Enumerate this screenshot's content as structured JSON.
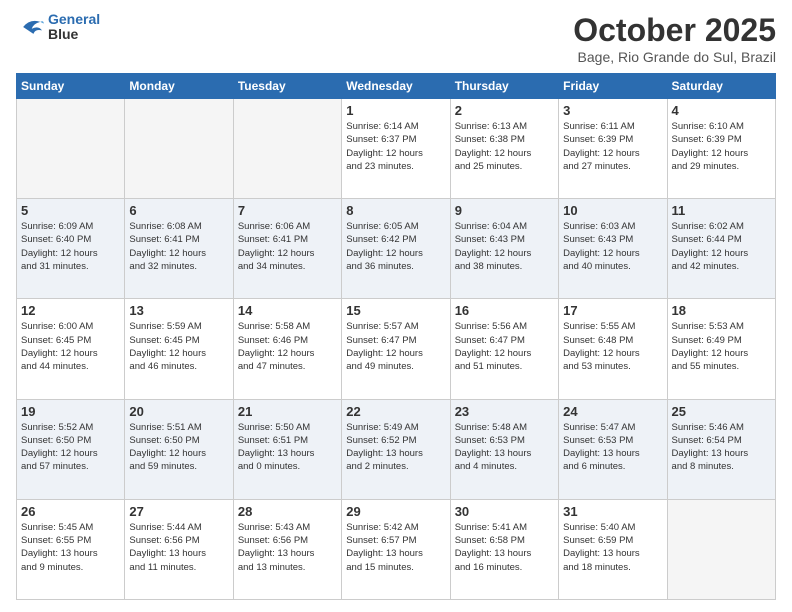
{
  "logo": {
    "line1": "General",
    "line2": "Blue"
  },
  "header": {
    "month": "October 2025",
    "location": "Bage, Rio Grande do Sul, Brazil"
  },
  "days_of_week": [
    "Sunday",
    "Monday",
    "Tuesday",
    "Wednesday",
    "Thursday",
    "Friday",
    "Saturday"
  ],
  "weeks": [
    {
      "alt": false,
      "days": [
        {
          "num": "",
          "info": ""
        },
        {
          "num": "",
          "info": ""
        },
        {
          "num": "",
          "info": ""
        },
        {
          "num": "1",
          "info": "Sunrise: 6:14 AM\nSunset: 6:37 PM\nDaylight: 12 hours\nand 23 minutes."
        },
        {
          "num": "2",
          "info": "Sunrise: 6:13 AM\nSunset: 6:38 PM\nDaylight: 12 hours\nand 25 minutes."
        },
        {
          "num": "3",
          "info": "Sunrise: 6:11 AM\nSunset: 6:39 PM\nDaylight: 12 hours\nand 27 minutes."
        },
        {
          "num": "4",
          "info": "Sunrise: 6:10 AM\nSunset: 6:39 PM\nDaylight: 12 hours\nand 29 minutes."
        }
      ]
    },
    {
      "alt": true,
      "days": [
        {
          "num": "5",
          "info": "Sunrise: 6:09 AM\nSunset: 6:40 PM\nDaylight: 12 hours\nand 31 minutes."
        },
        {
          "num": "6",
          "info": "Sunrise: 6:08 AM\nSunset: 6:41 PM\nDaylight: 12 hours\nand 32 minutes."
        },
        {
          "num": "7",
          "info": "Sunrise: 6:06 AM\nSunset: 6:41 PM\nDaylight: 12 hours\nand 34 minutes."
        },
        {
          "num": "8",
          "info": "Sunrise: 6:05 AM\nSunset: 6:42 PM\nDaylight: 12 hours\nand 36 minutes."
        },
        {
          "num": "9",
          "info": "Sunrise: 6:04 AM\nSunset: 6:43 PM\nDaylight: 12 hours\nand 38 minutes."
        },
        {
          "num": "10",
          "info": "Sunrise: 6:03 AM\nSunset: 6:43 PM\nDaylight: 12 hours\nand 40 minutes."
        },
        {
          "num": "11",
          "info": "Sunrise: 6:02 AM\nSunset: 6:44 PM\nDaylight: 12 hours\nand 42 minutes."
        }
      ]
    },
    {
      "alt": false,
      "days": [
        {
          "num": "12",
          "info": "Sunrise: 6:00 AM\nSunset: 6:45 PM\nDaylight: 12 hours\nand 44 minutes."
        },
        {
          "num": "13",
          "info": "Sunrise: 5:59 AM\nSunset: 6:45 PM\nDaylight: 12 hours\nand 46 minutes."
        },
        {
          "num": "14",
          "info": "Sunrise: 5:58 AM\nSunset: 6:46 PM\nDaylight: 12 hours\nand 47 minutes."
        },
        {
          "num": "15",
          "info": "Sunrise: 5:57 AM\nSunset: 6:47 PM\nDaylight: 12 hours\nand 49 minutes."
        },
        {
          "num": "16",
          "info": "Sunrise: 5:56 AM\nSunset: 6:47 PM\nDaylight: 12 hours\nand 51 minutes."
        },
        {
          "num": "17",
          "info": "Sunrise: 5:55 AM\nSunset: 6:48 PM\nDaylight: 12 hours\nand 53 minutes."
        },
        {
          "num": "18",
          "info": "Sunrise: 5:53 AM\nSunset: 6:49 PM\nDaylight: 12 hours\nand 55 minutes."
        }
      ]
    },
    {
      "alt": true,
      "days": [
        {
          "num": "19",
          "info": "Sunrise: 5:52 AM\nSunset: 6:50 PM\nDaylight: 12 hours\nand 57 minutes."
        },
        {
          "num": "20",
          "info": "Sunrise: 5:51 AM\nSunset: 6:50 PM\nDaylight: 12 hours\nand 59 minutes."
        },
        {
          "num": "21",
          "info": "Sunrise: 5:50 AM\nSunset: 6:51 PM\nDaylight: 13 hours\nand 0 minutes."
        },
        {
          "num": "22",
          "info": "Sunrise: 5:49 AM\nSunset: 6:52 PM\nDaylight: 13 hours\nand 2 minutes."
        },
        {
          "num": "23",
          "info": "Sunrise: 5:48 AM\nSunset: 6:53 PM\nDaylight: 13 hours\nand 4 minutes."
        },
        {
          "num": "24",
          "info": "Sunrise: 5:47 AM\nSunset: 6:53 PM\nDaylight: 13 hours\nand 6 minutes."
        },
        {
          "num": "25",
          "info": "Sunrise: 5:46 AM\nSunset: 6:54 PM\nDaylight: 13 hours\nand 8 minutes."
        }
      ]
    },
    {
      "alt": false,
      "days": [
        {
          "num": "26",
          "info": "Sunrise: 5:45 AM\nSunset: 6:55 PM\nDaylight: 13 hours\nand 9 minutes."
        },
        {
          "num": "27",
          "info": "Sunrise: 5:44 AM\nSunset: 6:56 PM\nDaylight: 13 hours\nand 11 minutes."
        },
        {
          "num": "28",
          "info": "Sunrise: 5:43 AM\nSunset: 6:56 PM\nDaylight: 13 hours\nand 13 minutes."
        },
        {
          "num": "29",
          "info": "Sunrise: 5:42 AM\nSunset: 6:57 PM\nDaylight: 13 hours\nand 15 minutes."
        },
        {
          "num": "30",
          "info": "Sunrise: 5:41 AM\nSunset: 6:58 PM\nDaylight: 13 hours\nand 16 minutes."
        },
        {
          "num": "31",
          "info": "Sunrise: 5:40 AM\nSunset: 6:59 PM\nDaylight: 13 hours\nand 18 minutes."
        },
        {
          "num": "",
          "info": ""
        }
      ]
    }
  ]
}
